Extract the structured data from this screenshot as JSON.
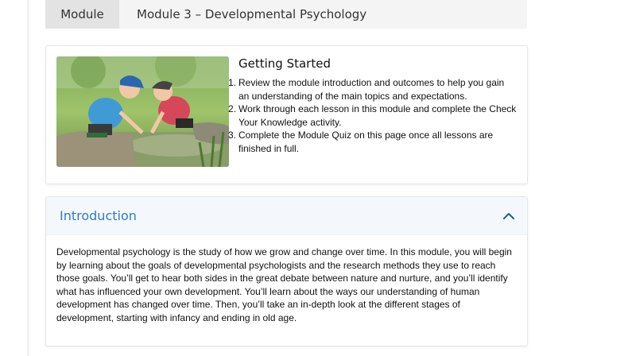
{
  "header": {
    "tag": "Module",
    "title": "Module 3 – Developmental Psychology"
  },
  "getting_started": {
    "title": "Getting Started",
    "image_alt": "two-children-playing-by-water",
    "steps": [
      {
        "num": "1.",
        "text": "Review the module introduction and outcomes to help you gain an understanding of the main topics and expectations."
      },
      {
        "num": "2.",
        "text": "Work through each lesson in this module and complete the Check Your Knowledge activity."
      },
      {
        "num": "3.",
        "text": "Complete the Module Quiz on this page once all lessons are finished in full."
      }
    ]
  },
  "introduction": {
    "title": "Introduction",
    "toggle_icon": "chevron-up-icon",
    "body": "Developmental psychology is the study of how we grow and change over time. In this module, you will begin by learning about the goals of developmental psychologists and the research methods they use to reach those goals. You’ll get to hear both sides in the great debate between nature and nurture, and you’ll identify what has influenced your own development. You’ll learn about the ways our understanding of human development has changed over time. Then, you’ll take an in-depth look at the different stages of development, starting with infancy and ending in old age."
  },
  "colors": {
    "accent": "#2f7cc4",
    "header_bg": "#f4f4f4",
    "tag_bg": "#e3e3e3"
  }
}
